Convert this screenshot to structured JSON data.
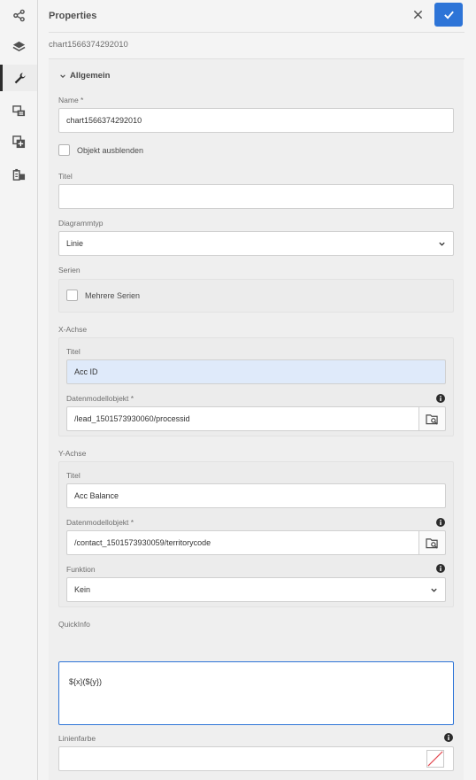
{
  "rail": {
    "items": [
      {
        "name": "share-icon"
      },
      {
        "name": "layers-icon"
      },
      {
        "name": "wrench-icon"
      },
      {
        "name": "content-tree-icon"
      },
      {
        "name": "add-item-icon"
      },
      {
        "name": "data-model-icon"
      }
    ]
  },
  "panel": {
    "title": "Properties",
    "component_id": "chart1566374292010"
  },
  "section": {
    "title": "Allgemein"
  },
  "name_field": {
    "label": "Name *",
    "value": "chart1566374292010"
  },
  "hide_object": {
    "label": "Objekt ausblenden",
    "checked": false
  },
  "title_field": {
    "label": "Titel",
    "value": ""
  },
  "chart_type": {
    "label": "Diagrammtyp",
    "value": "Linie"
  },
  "series": {
    "label": "Serien",
    "multi_label": "Mehrere Serien",
    "checked": false
  },
  "x_axis": {
    "label": "X-Achse",
    "title_label": "Titel",
    "title_value": "Acc ID",
    "datamodel_label": "Datenmodellobjekt *",
    "datamodel_value": "/lead_1501573930060/processid"
  },
  "y_axis": {
    "label": "Y-Achse",
    "title_label": "Titel",
    "title_value": "Acc Balance",
    "datamodel_label": "Datenmodellobjekt *",
    "datamodel_value": "/contact_1501573930059/territorycode",
    "function_label": "Funktion",
    "function_value": "Kein"
  },
  "quickinfo": {
    "label": "QuickInfo",
    "value": "${x}(${y})"
  },
  "line_color": {
    "label": "Linienfarbe"
  },
  "colors": {
    "accent": "#2d74d7",
    "highlight": "#dfeafa",
    "swatch_none": "#e34850"
  }
}
